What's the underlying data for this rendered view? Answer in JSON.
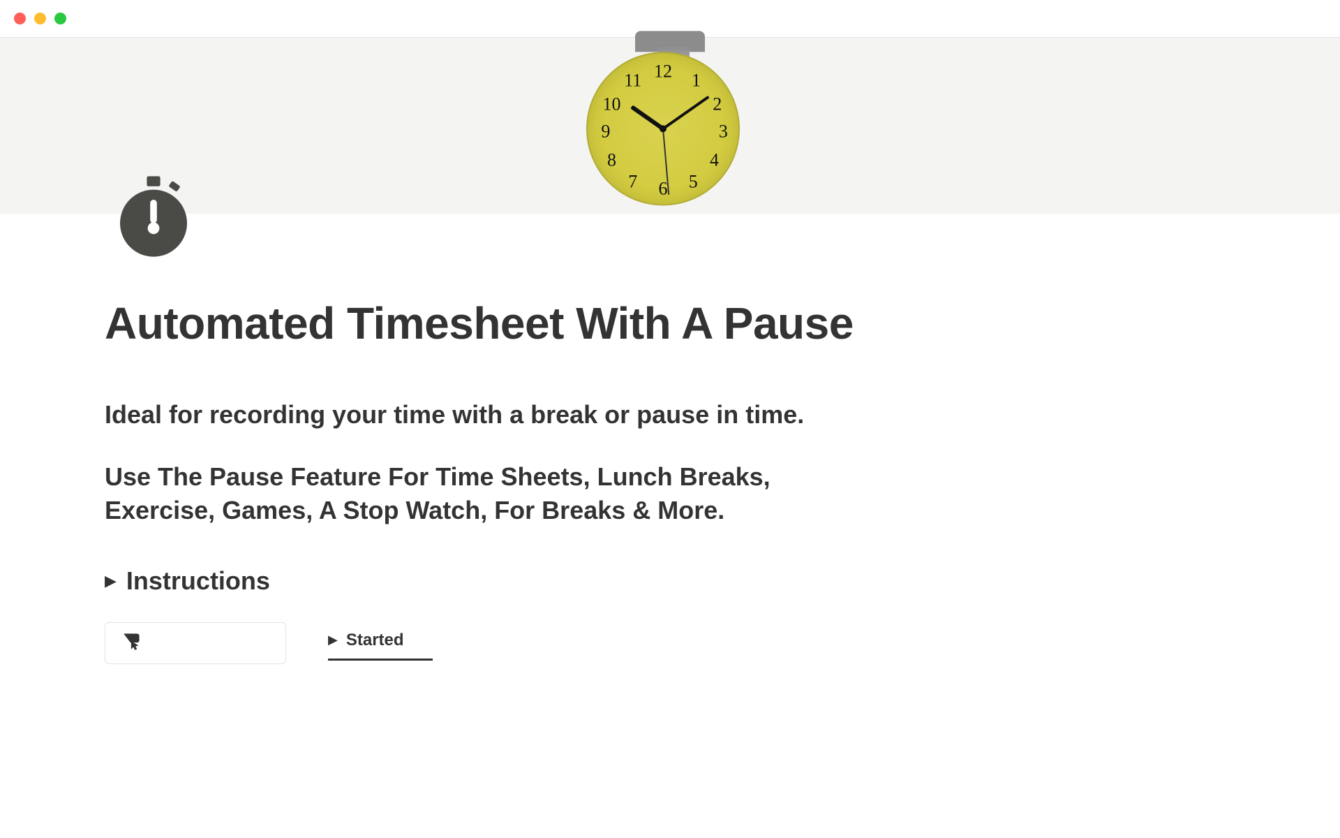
{
  "page": {
    "title": "Automated Timesheet With A Pause",
    "subtitle_primary": "Ideal for recording your time with a break or pause in time.",
    "subtitle_secondary": "Use The Pause Feature For Time Sheets, Lunch Breaks, Exercise, Games, A Stop Watch, For Breaks & More."
  },
  "toggles": {
    "instructions_label": "Instructions"
  },
  "view": {
    "tab_label": "Started"
  },
  "hero": {
    "clock_numbers": [
      "12",
      "1",
      "2",
      "3",
      "4",
      "5",
      "6",
      "7",
      "8",
      "9",
      "10",
      "11"
    ]
  }
}
